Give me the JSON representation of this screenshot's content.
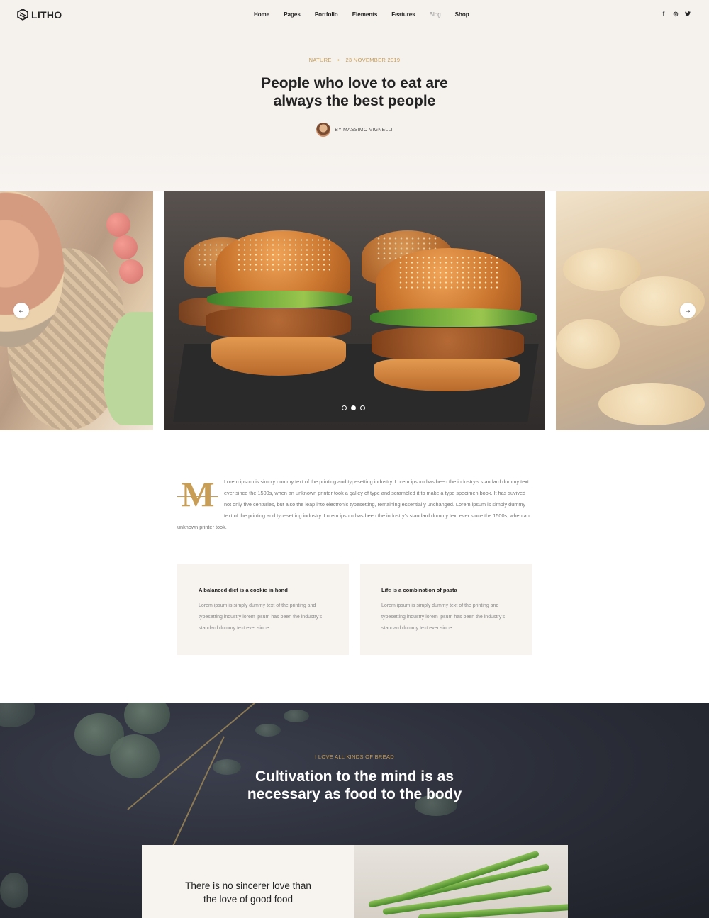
{
  "brand": {
    "name": "LITHO"
  },
  "nav": {
    "items": [
      {
        "label": "Home"
      },
      {
        "label": "Pages"
      },
      {
        "label": "Portfolio"
      },
      {
        "label": "Elements"
      },
      {
        "label": "Features"
      },
      {
        "label": "Blog",
        "active": true
      },
      {
        "label": "Shop"
      }
    ]
  },
  "social": {
    "facebook": "f",
    "instagram": "◎",
    "twitter": "t"
  },
  "post": {
    "category": "NATURE",
    "date": "23 NOVEMBER 2019",
    "title_line1": "People who love to eat are",
    "title_line2": "always the best people",
    "author": "BY MASSIMO VIGNELLI"
  },
  "slider": {
    "prev_icon": "←",
    "next_icon": "→",
    "active_index": 1,
    "dot_count": 3
  },
  "article": {
    "dropcap": "M",
    "text": "Lorem ipsum is simply dummy text of the printing and typesetting industry. Lorem ipsum has been the industry's standard dummy text ever since the 1500s, when an unknown printer took a galley of type and scrambled it to make a type specimen book. It has suvived not only five centuries, but also the leap into electronic typesetting, remaining essentially unchanged. Lorem ipsum is simply dummy text of the printing and typesetting industry. Lorem ipsum has been the industry's standard dummy text ever since the 1500s, when an unknown printer took."
  },
  "cards": [
    {
      "title": "A balanced diet is a cookie in hand",
      "text": "Lorem ipsum is simply dummy text of the printing and typesetting industry lorem ipsum has been the industry's standard dummy text ever since."
    },
    {
      "title": "Life is a combination of pasta",
      "text": "Lorem ipsum is simply dummy text of the printing and typesetting industry lorem ipsum has been the industry's standard dummy text ever since."
    }
  ],
  "feature": {
    "subtitle": "I LOVE ALL KINDS OF BREAD",
    "title_line1": "Cultivation to the mind is as",
    "title_line2": "necessary as food to the body",
    "quote_line1": "There is no sincerer love than",
    "quote_line2": "the love of good food"
  },
  "colors": {
    "accent": "#c89d55",
    "hero_bg": "#f5f1ed",
    "card_bg": "#f7f3ef",
    "text_dark": "#232323",
    "text_muted": "#757575"
  }
}
